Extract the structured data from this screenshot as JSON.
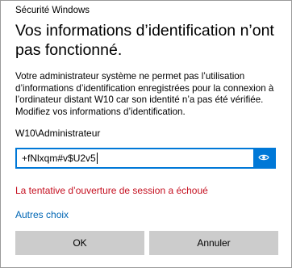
{
  "window": {
    "title": "Sécurité Windows"
  },
  "dialog": {
    "heading": "Vos informations d’identification n’ont pas fonctionné.",
    "message": "Votre administrateur système ne permet pas l’utilisation d’informations d’identification enregistrées pour la connexion à l’ordinateur distant W10 car son identité n’a pas été vérifiée. Modifiez vos informations d’identification.",
    "username": "W10\\Administrateur",
    "password_value": "+fNlxqm#v$U2v5",
    "reveal_icon": "eye-icon",
    "error": "La tentative d’ouverture de session a échoué",
    "more_choices": "Autres choix"
  },
  "buttons": {
    "ok": "OK",
    "cancel": "Annuler"
  },
  "colors": {
    "accent": "#0078d7",
    "error": "#c50f1f",
    "link": "#0066b4",
    "button_bg": "#cccccc"
  }
}
